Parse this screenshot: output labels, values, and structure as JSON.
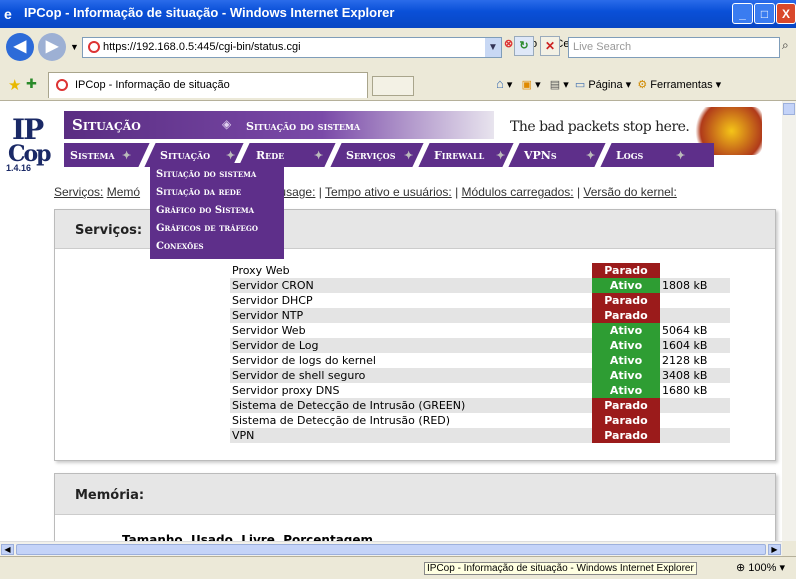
{
  "window": {
    "title": "IPCop - Informação de situação - Windows Internet Explorer",
    "minimize": "_",
    "maximize": "□",
    "close": "X"
  },
  "addressbar": {
    "url": "https://192.168.0.5:445/cgi-bin/status.cgi",
    "cert_error": "Erro do Certificado",
    "search_placeholder": "Live Search"
  },
  "tabs": {
    "active": "IPCop - Informação de situação",
    "page_menu": "Página",
    "tools_menu": "Ferramentas"
  },
  "ipcop": {
    "logo_top": "IP",
    "logo_bottom": "Cop",
    "version": "1.4.16",
    "section_title": "Situação",
    "section_subtitle": "Situação do sistema",
    "slogan": "The bad packets stop here.",
    "nav": [
      "Sistema",
      "Situação",
      "Rede",
      "Serviços",
      "Firewall",
      "VPNs",
      "Logs"
    ],
    "dropdown": [
      "Situação do sistema",
      "Situação da rede",
      "Gráfico do Sistema",
      "Gráficos de tráfego",
      "Conexões"
    ],
    "links_prefix": "Serviços:",
    "links_partial": "Memó",
    "links_rest": [
      "odes usage:",
      "Tempo ativo e usuários:",
      "Módulos carregados:",
      "Versão do kernel:"
    ]
  },
  "services": {
    "title": "Serviços:",
    "rows": [
      {
        "name": "Proxy Web",
        "status": "Parado",
        "mem": ""
      },
      {
        "name": "Servidor CRON",
        "status": "Ativo",
        "mem": "1808 kB"
      },
      {
        "name": "Servidor DHCP",
        "status": "Parado",
        "mem": ""
      },
      {
        "name": "Servidor NTP",
        "status": "Parado",
        "mem": ""
      },
      {
        "name": "Servidor Web",
        "status": "Ativo",
        "mem": "5064 kB"
      },
      {
        "name": "Servidor de Log",
        "status": "Ativo",
        "mem": "1604 kB"
      },
      {
        "name": "Servidor de logs do kernel",
        "status": "Ativo",
        "mem": "2128 kB"
      },
      {
        "name": "Servidor de shell seguro",
        "status": "Ativo",
        "mem": "3408 kB"
      },
      {
        "name": "Servidor proxy DNS",
        "status": "Ativo",
        "mem": "1680 kB"
      },
      {
        "name": "Sistema de Detecção de Intrusão (GREEN)",
        "status": "Parado",
        "mem": ""
      },
      {
        "name": "Sistema de Detecção de Intrusão (RED)",
        "status": "Parado",
        "mem": ""
      },
      {
        "name": "VPN",
        "status": "Parado",
        "mem": ""
      }
    ]
  },
  "memory": {
    "title": "Memória:",
    "columns": [
      "Tamanho",
      "Usado",
      "Livre",
      "Porcentagem"
    ]
  },
  "statusbar": {
    "tooltip": "IPCop - Informação de situação - Windows Internet Explorer",
    "zoom": "100%"
  }
}
